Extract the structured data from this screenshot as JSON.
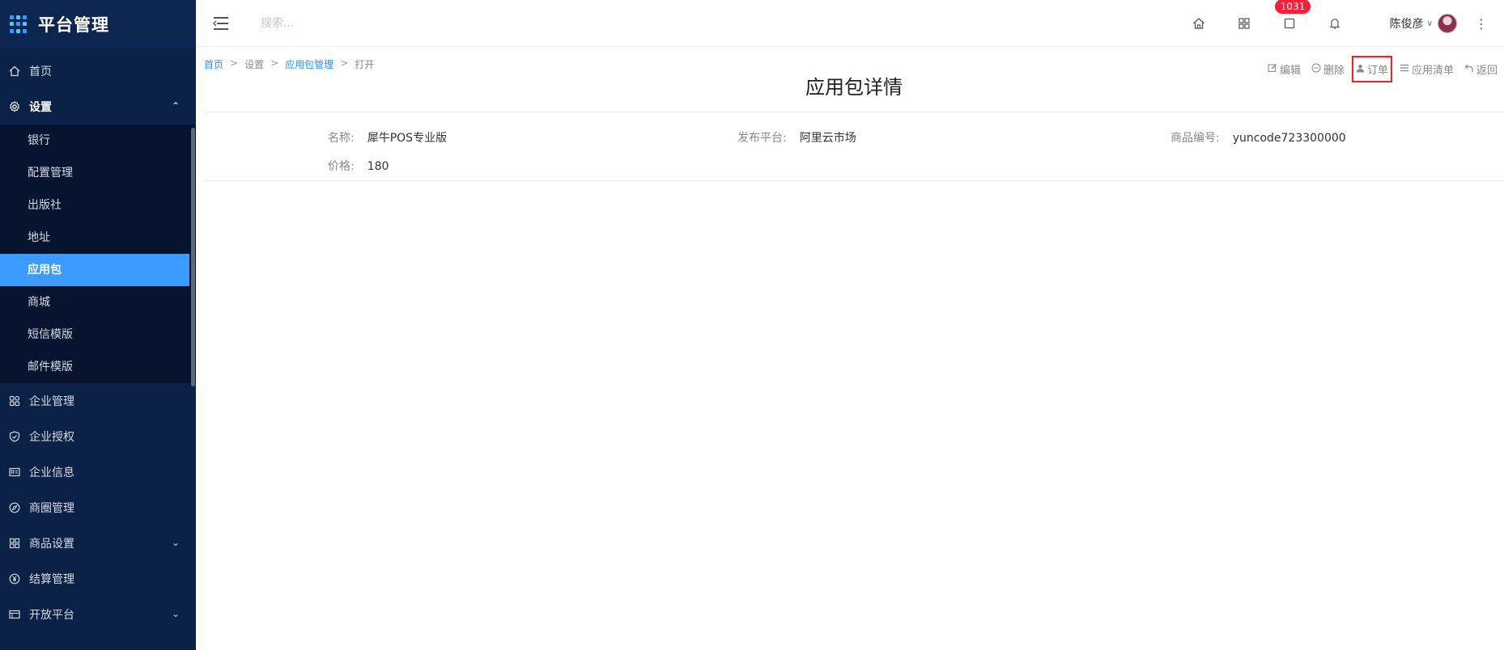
{
  "app": {
    "title": "平台管理"
  },
  "sidebar": {
    "items": [
      {
        "label": "首页",
        "icon": "home-icon"
      },
      {
        "label": "设置",
        "icon": "settings-icon"
      },
      {
        "label": "企业管理",
        "icon": "enterprise-icon"
      },
      {
        "label": "企业授权",
        "icon": "shield-icon"
      },
      {
        "label": "企业信息",
        "icon": "id-card-icon"
      },
      {
        "label": "商圈管理",
        "icon": "compass-icon"
      },
      {
        "label": "商品设置",
        "icon": "grid-icon"
      },
      {
        "label": "结算管理",
        "icon": "yen-icon"
      },
      {
        "label": "开放平台",
        "icon": "table-icon"
      }
    ],
    "submenu": [
      {
        "label": "银行"
      },
      {
        "label": "配置管理"
      },
      {
        "label": "出版社"
      },
      {
        "label": "地址"
      },
      {
        "label": "应用包"
      },
      {
        "label": "商城"
      },
      {
        "label": "短信模版"
      },
      {
        "label": "邮件模版"
      }
    ],
    "active": "应用包"
  },
  "topbar": {
    "search_placeholder": "搜索...",
    "badge_count": "1031",
    "username": "陈俊彦"
  },
  "breadcrumb": {
    "home": "首页",
    "settings": "设置",
    "pkg_manage": "应用包管理",
    "open": "打开",
    "sep": ">"
  },
  "actions": {
    "edit": "编辑",
    "delete": "删除",
    "order": "订单",
    "app_list": "应用清单",
    "back": "返回"
  },
  "page": {
    "title": "应用包详情"
  },
  "details": {
    "name_label": "名称:",
    "name_value": "犀牛POS专业版",
    "platform_label": "发布平台:",
    "platform_value": "阿里云市场",
    "code_label": "商品编号:",
    "code_value": "yuncode723300000",
    "price_label": "价格:",
    "price_value": "180"
  },
  "colors": {
    "sidebar_bg": "#0b2145",
    "submenu_bg": "#061430",
    "active_bg": "#3b9bff",
    "link": "#2a8ff7",
    "badge": "#f0213a",
    "highlight_border": "#ff1e1e"
  }
}
